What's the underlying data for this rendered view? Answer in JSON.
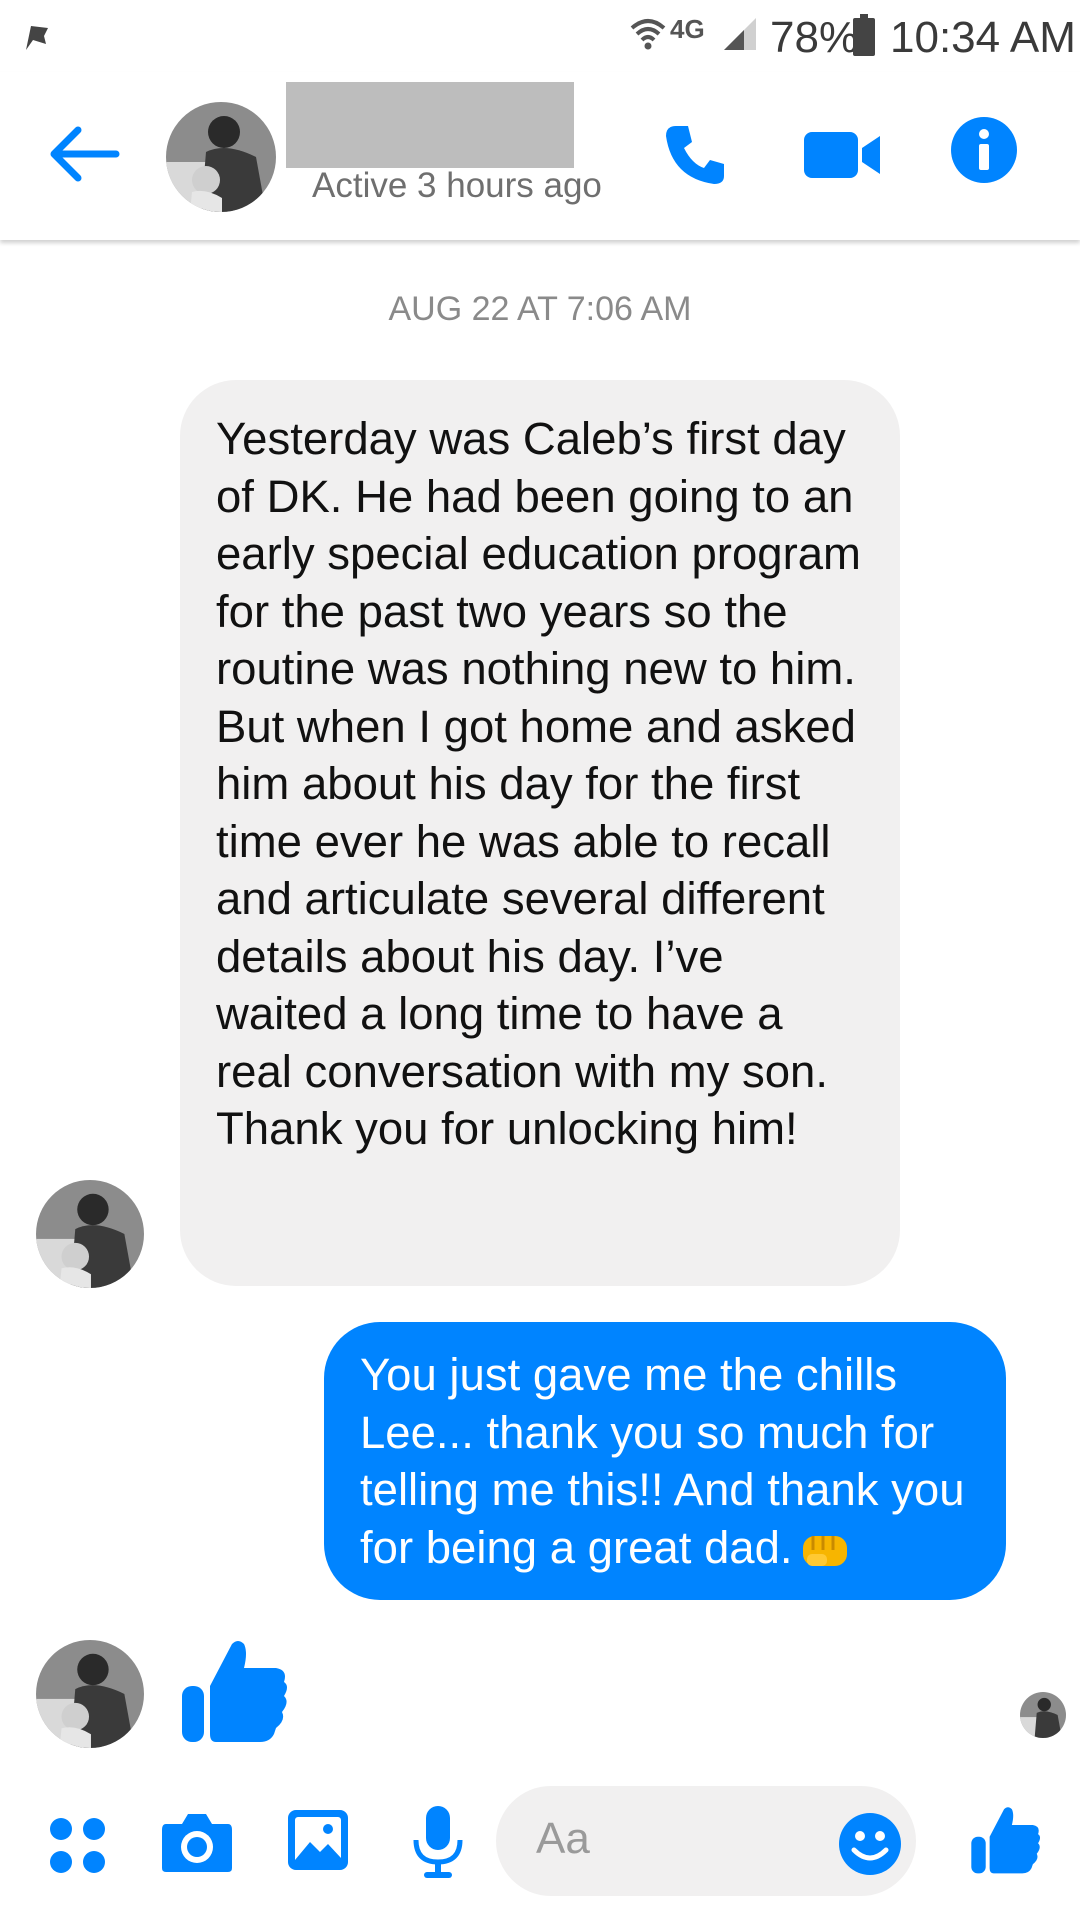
{
  "status_bar": {
    "network": "4G",
    "battery": "78%",
    "time": "10:34 AM"
  },
  "header": {
    "contact_name_redacted": true,
    "active_status": "Active 3 hours ago"
  },
  "conversation": {
    "timestamp": "AUG 22 AT 7:06 AM",
    "messages": [
      {
        "direction": "incoming",
        "text": "Yesterday was Caleb’s first day of DK. He had been going to an early special education program for the past two years so the routine was nothing new to him. But when I got home and asked him about his day for the first time ever he was able to recall and articulate several different details about his day. I’ve waited a long time to have a real conversation with my son. Thank you for unlocking him!"
      },
      {
        "direction": "outgoing",
        "text": "You just gave me the chills Lee... thank you so much for telling me this!! And thank you for being a great dad.",
        "emoji": "fist-bump"
      },
      {
        "direction": "incoming",
        "type": "like-sticker"
      }
    ]
  },
  "composer": {
    "placeholder": "Aa"
  },
  "colors": {
    "accent": "#0084ff",
    "incoming_bubble": "#f1f0f0",
    "redaction": "#bdbdbd"
  },
  "icons": [
    "back-arrow-icon",
    "phone-icon",
    "video-icon",
    "info-icon",
    "menu-dots-icon",
    "camera-icon",
    "gallery-icon",
    "mic-icon",
    "emoji-icon",
    "thumbs-up-icon"
  ]
}
